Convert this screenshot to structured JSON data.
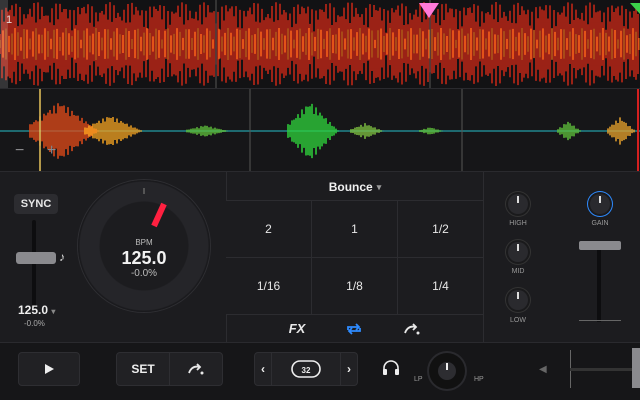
{
  "deck": {
    "number": "1"
  },
  "overview": {
    "cue_marker_color": "#ff7ad9",
    "end_marker_color": "#3cd24b"
  },
  "zoom": {
    "out": "−",
    "in": "+"
  },
  "sync": {
    "label": "SYNC"
  },
  "pitch": {
    "bpm": "125.0",
    "percent": "-0.0%"
  },
  "jog": {
    "bpm_label": "BPM",
    "bpm_value": "125.0",
    "pitch_value": "-0.0%",
    "indicator_color": "#ff2040"
  },
  "pads": {
    "mode": "Bounce",
    "values": [
      "2",
      "1",
      "1/2",
      "1/16",
      "1/8",
      "1/4"
    ]
  },
  "pad_footer": {
    "fx_label": "FX",
    "loop_color": "#2e8bff"
  },
  "eq": {
    "high": "HIGH",
    "mid": "MID",
    "low": "LOW",
    "gain": "GAIN"
  },
  "transport": {
    "set_label": "SET",
    "loop_length": "32",
    "filter_lp": "LP",
    "filter_hp": "HP"
  }
}
